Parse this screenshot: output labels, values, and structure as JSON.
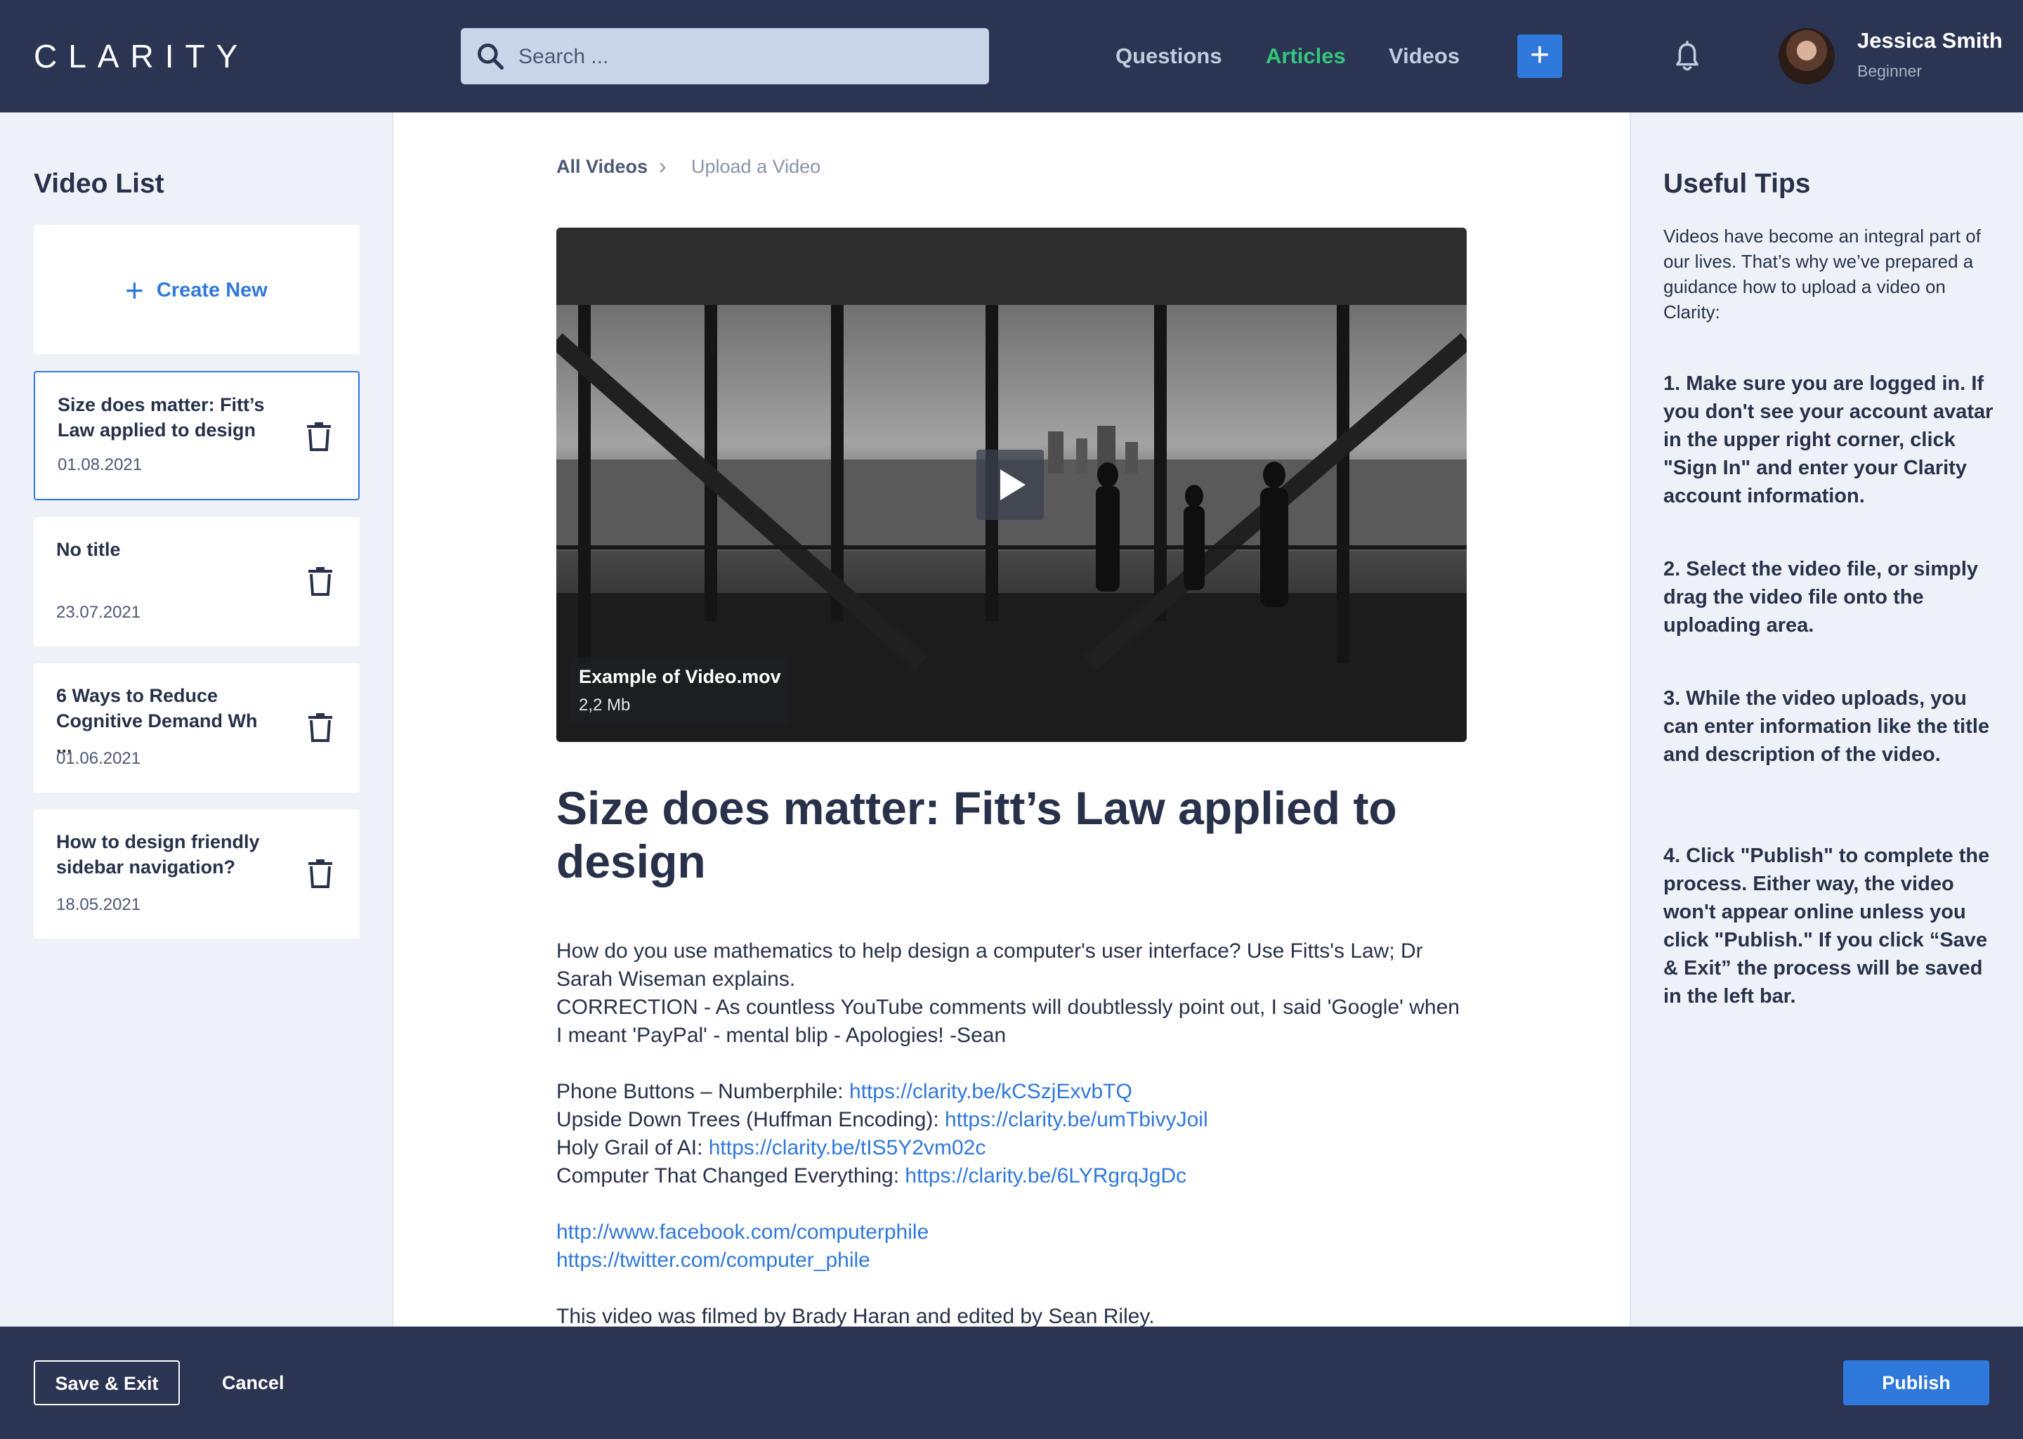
{
  "header": {
    "logo": "CLARITY",
    "search": {
      "placeholder": "Search ..."
    },
    "nav": [
      {
        "label": "Questions",
        "active": false
      },
      {
        "label": "Articles",
        "active": true
      },
      {
        "label": "Videos",
        "active": false
      }
    ],
    "add_button": "+",
    "user": {
      "name": "Jessica Smith",
      "level": "Beginner"
    }
  },
  "sidebar": {
    "title": "Video List",
    "create_new": "Create New",
    "items": [
      {
        "title": "Size does matter: Fitt’s Law applied to design",
        "date": "01.08.2021",
        "selected": true
      },
      {
        "title": "No title",
        "date": "23.07.2021",
        "selected": false
      },
      {
        "title": "6 Ways to Reduce Cognitive Demand Wh ...",
        "date": "01.06.2021",
        "selected": false
      },
      {
        "title": "How to design friendly sidebar navigation?",
        "date": "18.05.2021",
        "selected": false
      }
    ]
  },
  "main": {
    "breadcrumb": {
      "root": "All Videos",
      "separator": "›",
      "current": "Upload a Video"
    },
    "video": {
      "file_name": "Example of Video.mov",
      "file_size": "2,2 Mb"
    },
    "title": "Size does matter: Fitt’s Law applied to design",
    "description": {
      "para1": "How do you use mathematics to help design a computer's user interface? Use Fitts's Law; Dr Sarah Wiseman explains.",
      "para2": "CORRECTION - As countless YouTube comments will doubtlessly point out, I said 'Google' when I meant 'PayPal' - mental blip - Apologies! -Sean",
      "links": [
        {
          "label": "Phone Buttons – Numberphile: ",
          "url": "https://clarity.be/kCSzjExvbTQ"
        },
        {
          "label": "Upside Down Trees (Huffman Encoding): ",
          "url": "https://clarity.be/umTbivyJoil"
        },
        {
          "label": "Holy Grail of AI: ",
          "url": "https://clarity.be/tIS5Y2vm02c"
        },
        {
          "label": "Computer That Changed Everything: ",
          "url": "https://clarity.be/6LYRgrqJgDc"
        }
      ],
      "social": [
        "http://www.facebook.com/computerphile",
        "https://twitter.com/computer_phile"
      ],
      "credits": "This video was filmed by Brady Haran and edited by Sean Riley."
    }
  },
  "tips": {
    "title": "Useful Tips",
    "intro": "Videos have become an integral part of our lives. That’s why we’ve prepared a guidance how to upload a video on Clarity:",
    "steps": [
      "1. Make sure you are logged in. If you don't see your account avatar in the upper right corner, click \"Sign In\" and enter your Clarity account information.",
      "2. Select the video file, or simply drag the video file onto the uploading area.",
      "3. While the video uploads, you can enter information like the title and description of the video.",
      "4. Click \"Publish\" to complete the process. Either way, the video won't appear online unless you click \"Publish.\" If you click “Save & Exit” the process will be saved in the left bar."
    ]
  },
  "footer": {
    "save_exit": "Save & Exit",
    "cancel": "Cancel",
    "publish": "Publish"
  }
}
